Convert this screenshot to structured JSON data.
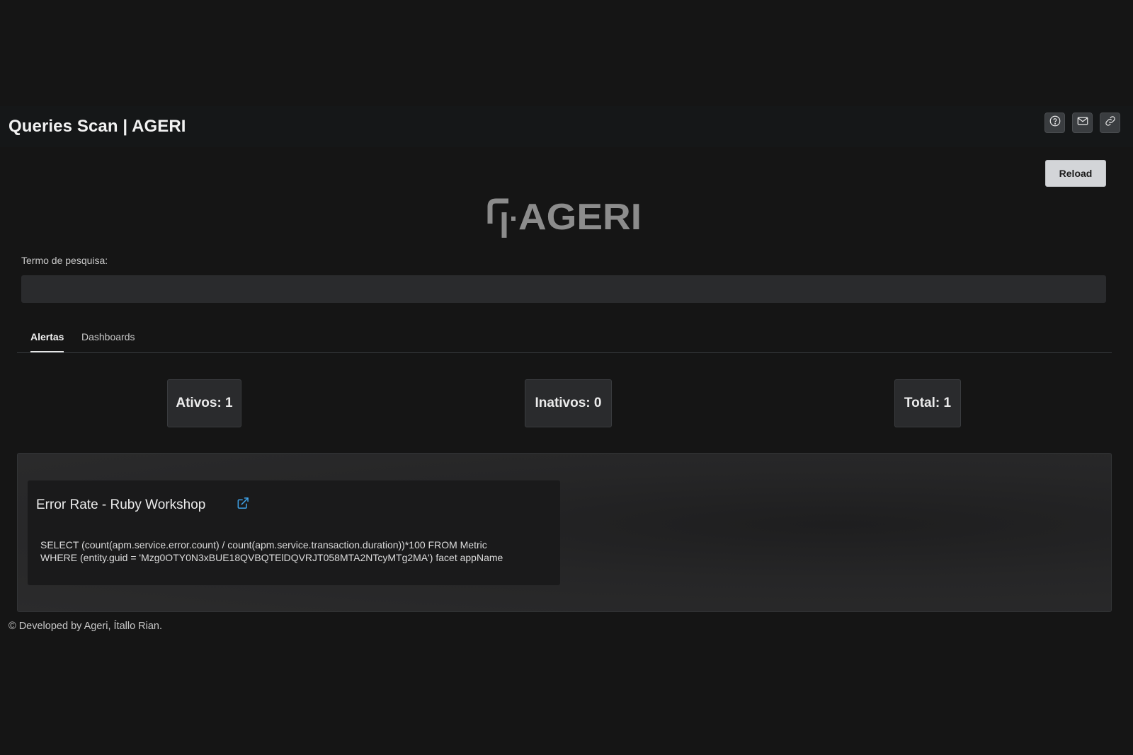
{
  "header": {
    "title": "Queries Scan | AGERI",
    "actions": [
      {
        "name": "help",
        "icon": "help-circle-icon"
      },
      {
        "name": "mail",
        "icon": "mail-icon"
      },
      {
        "name": "link",
        "icon": "link-icon"
      }
    ]
  },
  "toolbar": {
    "reload_label": "Reload"
  },
  "logo": {
    "text": "AGERI"
  },
  "search": {
    "label": "Termo de pesquisa:",
    "value": "",
    "placeholder": ""
  },
  "tabs": [
    {
      "label": "Alertas",
      "active": true
    },
    {
      "label": "Dashboards",
      "active": false
    }
  ],
  "stats": {
    "ativos": "Ativos: 1",
    "inativos": "Inativos: 0",
    "total": "Total: 1"
  },
  "alerts": [
    {
      "title": "Error Rate - Ruby Workshop",
      "link_icon": "external-link-icon",
      "query": "SELECT (count(apm.service.error.count) / count(apm.service.transaction.duration))*100 FROM Metric\nWHERE (entity.guid = 'Mzg0OTY0N3xBUE18QVBQTElDQVRJT058MTA2NTcyMTg2MA') facet appName"
    }
  ],
  "footer": {
    "text": "© Developed by Ageri, Ítallo Rian."
  },
  "colors": {
    "background": "#151515",
    "surface": "#2a2b2d",
    "accent_link": "#3fa2e8",
    "button_light": "#d3d5d8"
  }
}
